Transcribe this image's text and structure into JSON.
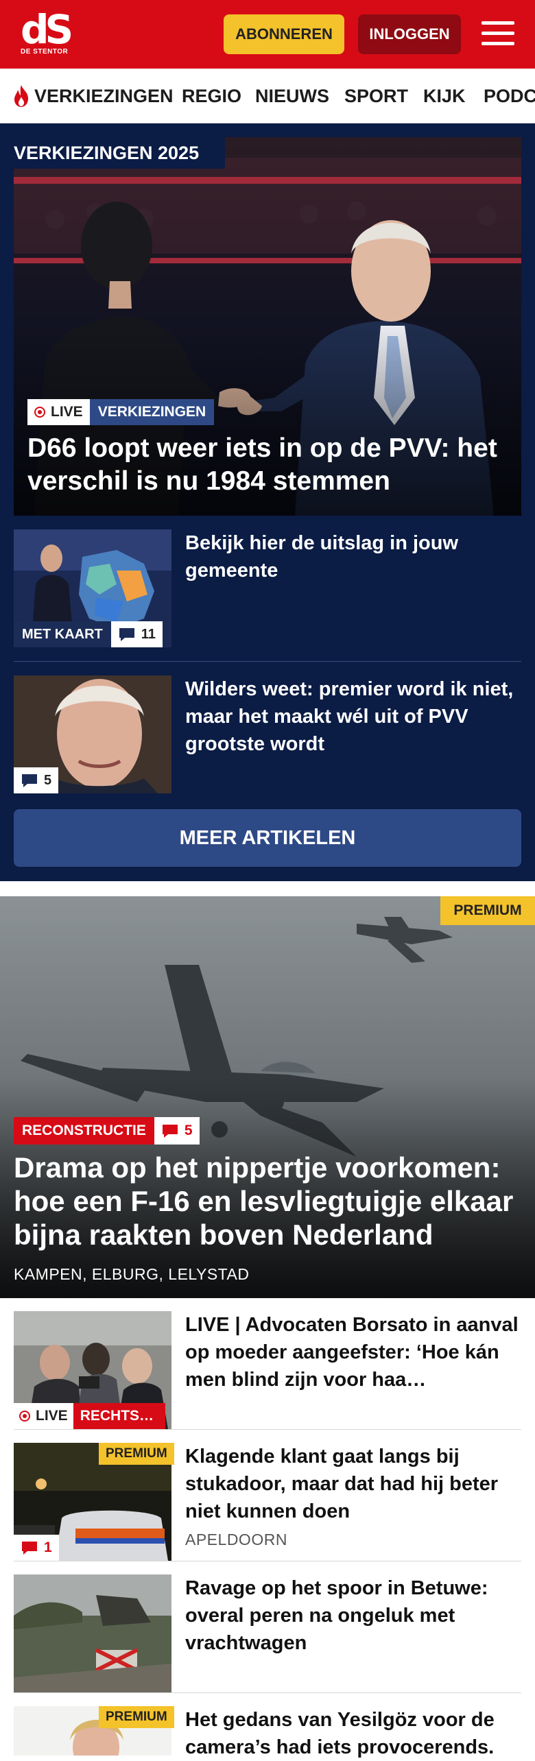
{
  "header": {
    "logo_text": "dS",
    "logo_subtitle": "DE STENTOR",
    "subscribe_label": "ABONNEREN",
    "login_label": "INLOGGEN",
    "menu_icon": "hamburger-icon"
  },
  "nav": {
    "items": [
      {
        "label": "VERKIEZINGEN",
        "icon": "flame-icon"
      },
      {
        "label": "REGIO"
      },
      {
        "label": "NIEUWS"
      },
      {
        "label": "SPORT"
      },
      {
        "label": "KIJK"
      },
      {
        "label": "PODC"
      }
    ]
  },
  "election": {
    "section_title": "VERKIEZINGEN 2025",
    "hero": {
      "live_label": "LIVE",
      "category": "VERKIEZINGEN",
      "title": "D66 loopt weer iets in op de PVV: het verschil is nu 1984 stemmen"
    },
    "articles": [
      {
        "title": "Bekijk hier de uitslag in jouw gemeente",
        "tag": "MET KAART",
        "comments": "11"
      },
      {
        "title": "Wilders weet: premier word ik niet, maar het maakt wél uit of PVV grootste wordt",
        "comments": "5"
      }
    ],
    "more_label": "MEER ARTIKELEN"
  },
  "featured": {
    "premium_label": "PREMIUM",
    "category": "RECONSTRUCTIE",
    "comments": "5",
    "title": "Drama op het nippertje voorkomen: hoe een F-16 en lesvliegtuigje elkaar bijna raakten boven Nederland",
    "location": "KAMPEN, ELBURG, LELYSTAD"
  },
  "list": [
    {
      "title": "LIVE | Advocaten Borsato in aanval op moeder aangeefster: ‘Hoe kán men blind zijn voor haa…",
      "live_label": "LIVE",
      "category": "RECHTS…"
    },
    {
      "title": "Klagende klant gaat langs bij stukadoor, maar dat had hij beter niet kunnen doen",
      "premium_label": "PREMIUM",
      "comments": "1",
      "location": "APELDOORN"
    },
    {
      "title": "Ravage op het spoor in Betuwe: overal peren na ongeluk met vrachtwagen"
    },
    {
      "title": "Het gedans van Yesilgöz voor de camera’s had iets provocerends.",
      "premium_label": "PREMIUM"
    }
  ],
  "colors": {
    "brand_red": "#d70b16",
    "navy": "#0b1c45",
    "accent_blue": "#2e4a86",
    "premium_yellow": "#f4c22a"
  }
}
